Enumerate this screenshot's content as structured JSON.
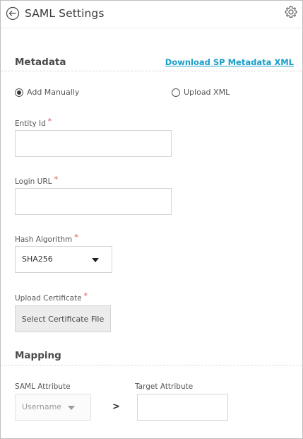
{
  "header": {
    "title": "SAML Settings",
    "back_icon": "arrow-left-circle-icon",
    "settings_icon": "gear-icon"
  },
  "metadata": {
    "section_title": "Metadata",
    "download_link": "Download SP Metadata XML",
    "radio_add_manually": "Add Manually",
    "radio_upload_xml": "Upload XML",
    "selected_option": "Add Manually"
  },
  "fields": {
    "entity_id": {
      "label": "Entity Id",
      "required_mark": "*",
      "value": ""
    },
    "login_url": {
      "label": "Login URL",
      "required_mark": "*",
      "value": ""
    },
    "hash_algorithm": {
      "label": "Hash Algorithm",
      "required_mark": "*",
      "value": "SHA256"
    },
    "upload_certificate": {
      "label": "Upload Certificate",
      "required_mark": "*",
      "button_label": "Select Certificate File"
    }
  },
  "mapping": {
    "section_title": "Mapping",
    "saml_attribute_label": "SAML Attribute",
    "target_attribute_label": "Target Attribute",
    "saml_attribute_value": "Username",
    "arrow": ">",
    "target_attribute_value": ""
  },
  "colors": {
    "link": "#1a9dc7",
    "required": "#e0474c",
    "border": "#d4d4d4"
  }
}
